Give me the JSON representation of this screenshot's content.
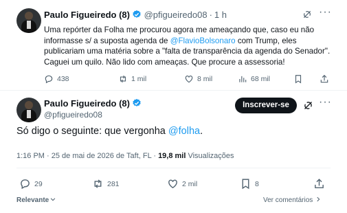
{
  "tweet1": {
    "author_name": "Paulo Figueiredo (8)",
    "handle": "@pfigueiredo08",
    "separator": "·",
    "time": "1 h",
    "text_before_mention": "Uma repórter da Folha me procurou agora me ameaçando que, caso eu não informasse s/ a suposta agenda de ",
    "mention": "@FlavioBolsonaro",
    "text_after_mention": " com Trump, eles publicariam uma matéria sobre a \"falta de transparência da agenda do Senador\". Caguei um quilo. Não lido com ameaças. Que procure a assessoria!",
    "more": "···",
    "actions": {
      "replies": "438",
      "reposts": "1 mil",
      "likes": "8 mil",
      "views": "68 mil"
    }
  },
  "tweet2": {
    "author_name": "Paulo Figueiredo (8)",
    "handle": "@pfigueiredo08",
    "follow_label": "Inscrever-se",
    "more": "···",
    "text_before_link": "Só digo o seguinte: que vergonha ",
    "link": "@folha",
    "text_after_link": ".",
    "meta_time": "1:16 PM · 25 de mai de 2026 de Taft, FL · ",
    "meta_views_count": "19,8 mil",
    "meta_views_label": " Visualizações",
    "actions": {
      "replies": "29",
      "reposts": "281",
      "likes": "2 mil",
      "bookmarks": "8"
    }
  },
  "footer": {
    "sort_label": "Relevante",
    "see_comments": "Ver comentários"
  },
  "colors": {
    "accent": "#1d9bf0",
    "text": "#0f1419",
    "muted": "#536471",
    "divider": "#eff3f4"
  }
}
